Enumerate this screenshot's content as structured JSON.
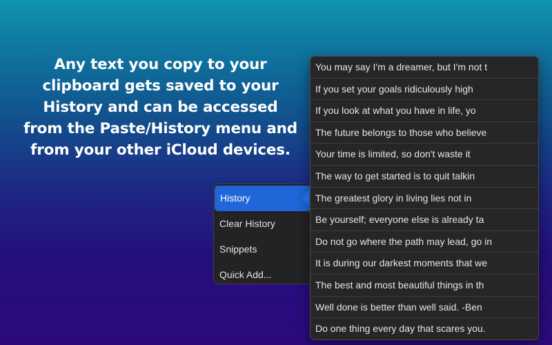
{
  "headline": {
    "lines": [
      "Any text you copy to your",
      "clipboard gets saved to your",
      "History and can be accessed",
      "from the Paste/History menu and",
      "from your other iCloud devices."
    ]
  },
  "side_menu": {
    "items": [
      {
        "label": "History",
        "selected": true
      },
      {
        "label": "Clear History",
        "selected": false
      },
      {
        "label": "Snippets",
        "selected": false
      },
      {
        "label": "Quick Add...",
        "selected": false
      }
    ]
  },
  "history_menu": {
    "items": [
      "You may say I'm a dreamer, but I'm not t",
      "If you set your goals ridiculously high",
      "If you look at what you have in life, yo",
      "The future belongs to those who believe",
      "Your time is limited, so don't waste it",
      "The way to get started is to quit talkin",
      "The greatest glory in living lies not in",
      "Be yourself; everyone else is already ta",
      "Do not go where the path may lead, go in",
      "It is during our darkest moments that we",
      "The best and most beautiful things in th",
      "Well done is better than well said. -Ben",
      "Do one thing every day that scares you."
    ]
  },
  "colors": {
    "accent": "#1f66d8",
    "menu_background": "#262628"
  }
}
